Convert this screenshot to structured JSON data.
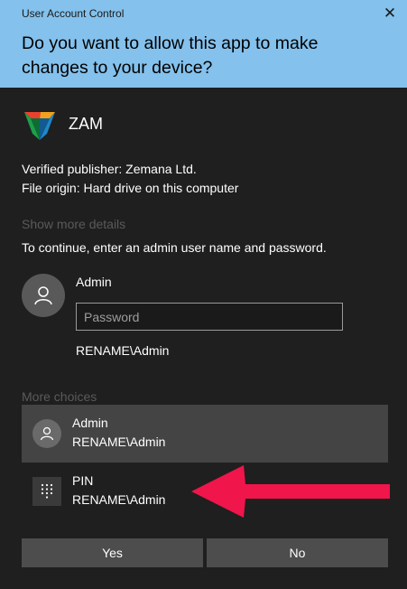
{
  "window": {
    "title": "User Account Control",
    "close_glyph": "✕",
    "question": "Do you want to allow this app to make changes to your device?",
    "header_color": "#84c1ec"
  },
  "app": {
    "name": "ZAM",
    "icon": "zam-shield-logo",
    "publisher": "Verified publisher: Zemana Ltd.",
    "origin": "File origin: Hard drive on this computer"
  },
  "show_more_details": "Show more details",
  "instruction": "To continue, enter an admin user name and password.",
  "credential": {
    "username": "Admin",
    "password_placeholder": "Password",
    "password_value": "",
    "domain": "RENAME\\Admin",
    "avatar_icon": "user-icon"
  },
  "more_choices": {
    "label": "More choices",
    "options": [
      {
        "line1": "Admin",
        "line2": "RENAME\\Admin",
        "icon": "user-icon",
        "selected": true
      },
      {
        "line1": "PIN",
        "line2": "RENAME\\Admin",
        "icon": "keypad-icon",
        "selected": false
      }
    ]
  },
  "annotation": {
    "icon": "red-arrow",
    "color": "#f0154a"
  },
  "buttons": {
    "yes": "Yes",
    "no": "No"
  }
}
